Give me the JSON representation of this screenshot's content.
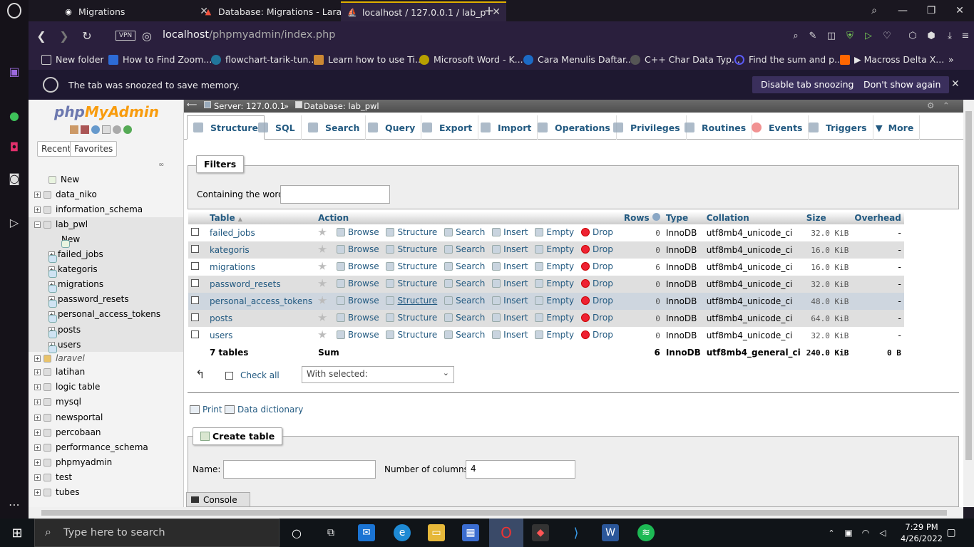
{
  "browser": {
    "tabs": [
      {
        "label": "Migrations"
      },
      {
        "label": "Database: Migrations - Lara"
      },
      {
        "label": "localhost / 127.0.0.1 / lab_p"
      }
    ],
    "url_host": "localhost",
    "url_path": "/phpmyadmin/index.php",
    "vpn_label": "VPN",
    "bookmarks": [
      "New folder",
      "How to Find Zoom...",
      "flowchart-tarik-tun...",
      "Learn how to use Ti...",
      "Microsoft Word - K...",
      "Cara Menulis Daftar...",
      "C++ Char Data Typ...",
      "Find the sum and p...",
      "▶ Macross Delta X..."
    ],
    "snooze": {
      "text": "The tab was snoozed to save memory.",
      "disable": "Disable tab snoozing",
      "dont_show": "Don't show again"
    }
  },
  "sidebar": {
    "logo_php": "php",
    "logo_myadmin": "MyAdmin",
    "recent": "Recent",
    "favorites": "Favorites",
    "databases": [
      {
        "name": "New"
      },
      {
        "name": "data_niko"
      },
      {
        "name": "information_schema"
      },
      {
        "name": "lab_pwl"
      },
      {
        "name": "New"
      },
      {
        "name": "failed_jobs"
      },
      {
        "name": "kategoris"
      },
      {
        "name": "migrations"
      },
      {
        "name": "password_resets"
      },
      {
        "name": "personal_access_tokens"
      },
      {
        "name": "posts"
      },
      {
        "name": "users"
      },
      {
        "name": "laravel"
      },
      {
        "name": "latihan"
      },
      {
        "name": "logic table"
      },
      {
        "name": "mysql"
      },
      {
        "name": "newsportal"
      },
      {
        "name": "percobaan"
      },
      {
        "name": "performance_schema"
      },
      {
        "name": "phpmyadmin"
      },
      {
        "name": "test"
      },
      {
        "name": "tubes"
      }
    ]
  },
  "breadcrumb": {
    "server": "Server: 127.0.0.1",
    "sep": "»",
    "database": "Database: lab_pwl"
  },
  "tabs": [
    "Structure",
    "SQL",
    "Search",
    "Query",
    "Export",
    "Import",
    "Operations",
    "Privileges",
    "Routines",
    "Events",
    "Triggers",
    "More"
  ],
  "filters": {
    "legend": "Filters",
    "label": "Containing the word:",
    "value": ""
  },
  "table": {
    "headers": {
      "table": "Table",
      "action": "Action",
      "rows": "Rows",
      "type": "Type",
      "collation": "Collation",
      "size": "Size",
      "overhead": "Overhead"
    },
    "action_labels": {
      "browse": "Browse",
      "structure": "Structure",
      "search": "Search",
      "insert": "Insert",
      "empty": "Empty",
      "drop": "Drop"
    },
    "rows": [
      {
        "name": "failed_jobs",
        "rows": "0",
        "type": "InnoDB",
        "collation": "utf8mb4_unicode_ci",
        "size": "32.0 KiB",
        "overhead": "-"
      },
      {
        "name": "kategoris",
        "rows": "0",
        "type": "InnoDB",
        "collation": "utf8mb4_unicode_ci",
        "size": "16.0 KiB",
        "overhead": "-"
      },
      {
        "name": "migrations",
        "rows": "6",
        "type": "InnoDB",
        "collation": "utf8mb4_unicode_ci",
        "size": "16.0 KiB",
        "overhead": "-"
      },
      {
        "name": "password_resets",
        "rows": "0",
        "type": "InnoDB",
        "collation": "utf8mb4_unicode_ci",
        "size": "32.0 KiB",
        "overhead": "-"
      },
      {
        "name": "personal_access_tokens",
        "rows": "0",
        "type": "InnoDB",
        "collation": "utf8mb4_unicode_ci",
        "size": "48.0 KiB",
        "overhead": "-"
      },
      {
        "name": "posts",
        "rows": "0",
        "type": "InnoDB",
        "collation": "utf8mb4_unicode_ci",
        "size": "64.0 KiB",
        "overhead": "-"
      },
      {
        "name": "users",
        "rows": "0",
        "type": "InnoDB",
        "collation": "utf8mb4_unicode_ci",
        "size": "32.0 KiB",
        "overhead": "-"
      }
    ],
    "summary": {
      "count": "7 tables",
      "label": "Sum",
      "rows": "6",
      "type": "InnoDB",
      "collation": "utf8mb4_general_ci",
      "size": "240.0 KiB",
      "overhead": "0 B"
    }
  },
  "bulk": {
    "check_all": "Check all",
    "with_selected": "With selected:"
  },
  "links": {
    "print": "Print",
    "dictionary": "Data dictionary"
  },
  "create_table": {
    "legend": "Create table",
    "name_label": "Name:",
    "name_value": "",
    "columns_label": "Number of columns:",
    "columns_value": "4"
  },
  "console": "Console",
  "taskbar": {
    "search": "Type here to search",
    "time": "7:29 PM",
    "date": "4/26/2022"
  }
}
